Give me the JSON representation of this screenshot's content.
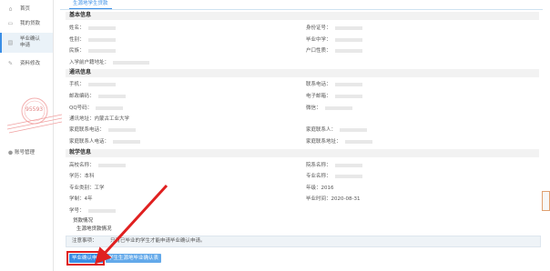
{
  "sidebar": {
    "items": [
      {
        "label": "首页",
        "icon": "home-icon"
      },
      {
        "label": "我的贷款",
        "icon": "folder-icon"
      },
      {
        "label": "毕业确认\n申请",
        "icon": "document-icon",
        "active": true
      },
      {
        "label": "资料修改",
        "icon": "edit-icon"
      }
    ],
    "bottom_label": "账号管理"
  },
  "stamp": {
    "number": "95593"
  },
  "tab": {
    "label": "生源地学生贷款"
  },
  "sections": {
    "basic": "基本信息",
    "contact": "通讯信息",
    "study": "就学信息"
  },
  "basic": {
    "name": "姓名：",
    "id_no": "身份证号：",
    "gender": "性别：",
    "hs_grad": "毕业中学：",
    "ethnicity": "民族：",
    "hukou": "户口性质：",
    "hukou_addr": "入学前户籍地址："
  },
  "contact": {
    "mobile": "手机：",
    "phone": "联系电话：",
    "postcode": "邮政编码：",
    "email": "电子邮箱：",
    "qq": "QQ号码：",
    "wechat": "微信：",
    "address_label": "通讯地址：",
    "address_value": "内蒙古工业大学",
    "family_phone": "家庭联系电话：",
    "family_contact": "家庭联系人：",
    "family_contact_phone": "家庭联系人电话：",
    "family_addr": "家庭联系地址："
  },
  "study": {
    "school": "高校名称：",
    "faculty": "院系名称：",
    "edu_label": "学历：",
    "edu_value": "本科",
    "major": "专业名称：",
    "type_label": "专业类别：",
    "type_value": "工学",
    "grade_label": "年级：",
    "grade_value": "2016",
    "years_label": "学制：",
    "years_value": "4年",
    "grad_label": "毕业时间：",
    "grad_value": "2020-08-31",
    "student_no": "学号："
  },
  "loan": {
    "title": "贷款情况",
    "subtitle": "生源地贷款情况"
  },
  "notice": {
    "key": "注意事项：",
    "text": "只有已毕业的学生才能申请毕业确认申请。"
  },
  "buttons": {
    "apply": "毕业确认申请",
    "confirm_form": "学生生源地毕业确认表"
  },
  "colors": {
    "accent": "#3a8ee6",
    "highlight": "#e02020"
  }
}
